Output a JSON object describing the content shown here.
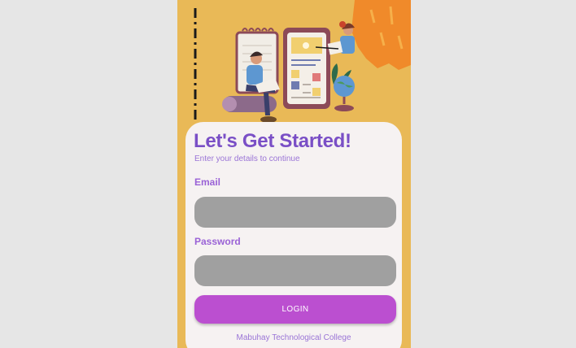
{
  "login": {
    "title": "Let's Get Started!",
    "subtitle": "Enter your details to continue",
    "email_label": "Email",
    "email_value": "",
    "password_label": "Password",
    "password_value": "",
    "button_label": "LOGIN",
    "footer": "Mabuhay Technological College"
  },
  "colors": {
    "background": "#e9b957",
    "title": "#7a4fc6",
    "button": "#bb4fd0",
    "field": "#a0a0a0"
  }
}
